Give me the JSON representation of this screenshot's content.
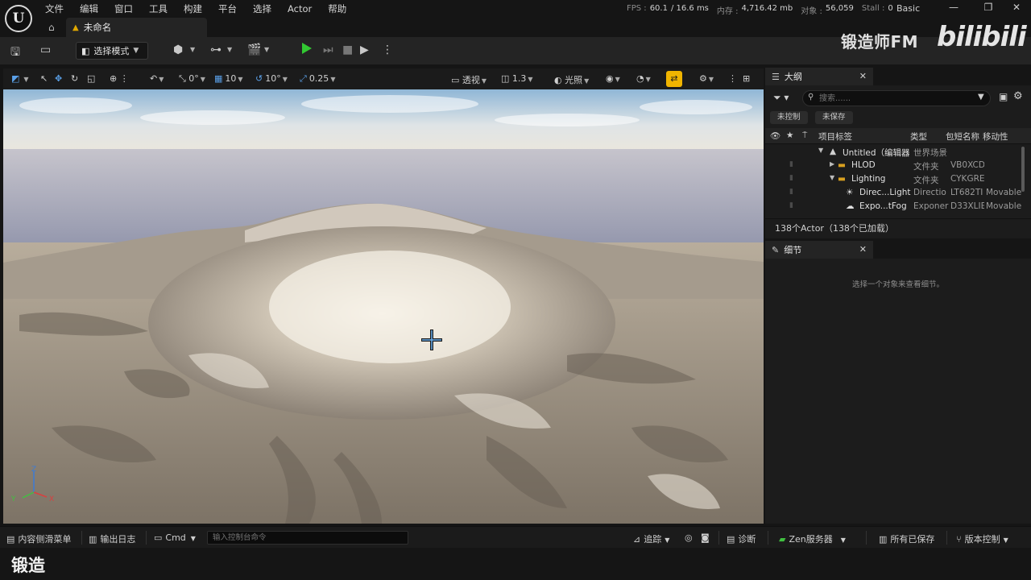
{
  "app": {
    "logo_glyph": "U",
    "menus": [
      "文件",
      "编辑",
      "窗口",
      "工具",
      "构建",
      "平台",
      "选择",
      "Actor",
      "帮助"
    ],
    "stats": {
      "fps_label": "FPS :",
      "fps_value": "60.1",
      "ms_value": "/ 16.6 ms",
      "mem_label": "内存 :",
      "mem_value": "4,716.42 mb",
      "obj_label": "对象 :",
      "obj_value": "56,059",
      "stall_label": "Stall :",
      "stall_value": "0"
    },
    "layout_name": "Basic",
    "window_controls": {
      "minimize": "—",
      "restore": "❐",
      "close": "✕"
    }
  },
  "tab": {
    "label": "未命名"
  },
  "toolbar": {
    "mode_label": "选择模式",
    "icons": [
      "save-icon",
      "content-browser-icon",
      "add-actor-icon",
      "blueprint-icon",
      "cinematics-icon",
      "play-icon",
      "advance-icon",
      "stop-icon",
      "simulate-icon",
      "more-icon"
    ]
  },
  "watermark": {
    "brand": "锻造师FM",
    "site": "bilibili"
  },
  "viewport": {
    "toolbar": {
      "translate_snap": "0°",
      "grid_snap": "10",
      "rotate_snap": "10°",
      "scale_snap": "0.25",
      "view_mode": "透视",
      "camera_speed": "1.3",
      "lit_mode": "光照"
    },
    "axis_labels": {
      "z": "Z",
      "y": "Y",
      "x": "X"
    }
  },
  "outliner": {
    "tab_label": "大纲",
    "search_placeholder": "搜索......",
    "chips": [
      "未控制",
      "未保存"
    ],
    "columns": {
      "label": "项目标签",
      "type": "类型",
      "package": "包短名称",
      "mobility": "移动性"
    },
    "rows": [
      {
        "name": "Untitled（编辑器",
        "type": "世界场景",
        "pkg": "",
        "mob": ""
      },
      {
        "name": "HLOD",
        "type": "文件夹",
        "pkg": "VB0XCD",
        "mob": ""
      },
      {
        "name": "Lighting",
        "type": "文件夹",
        "pkg": "CYKGRE",
        "mob": ""
      },
      {
        "name": "Direc...Light",
        "type": "Directio",
        "pkg": "LT682TI",
        "mob": "Movable"
      },
      {
        "name": "Expo...tFog",
        "type": "Exponer",
        "pkg": "D33XLIE",
        "mob": "Movable"
      }
    ],
    "actor_count": "138个Actor（138个已加载）"
  },
  "details": {
    "tab_label": "细节",
    "empty_text": "选择一个对象来查看细节。"
  },
  "statusbar": {
    "content_drawer": "内容侧滑菜单",
    "output_log": "输出日志",
    "cmd": "Cmd",
    "console_placeholder": "输入控制台命令",
    "trace": "追踪",
    "diagnostics": "诊断",
    "zen": "Zen服务器",
    "all_saved": "所有已保存",
    "source_control": "版本控制"
  },
  "subtitle": "锻造",
  "colors": {
    "accent_snap": "#f0b400",
    "play_green": "#32c832",
    "panel_bg": "#1c1c1c",
    "folder_yellow": "#d8a020"
  }
}
